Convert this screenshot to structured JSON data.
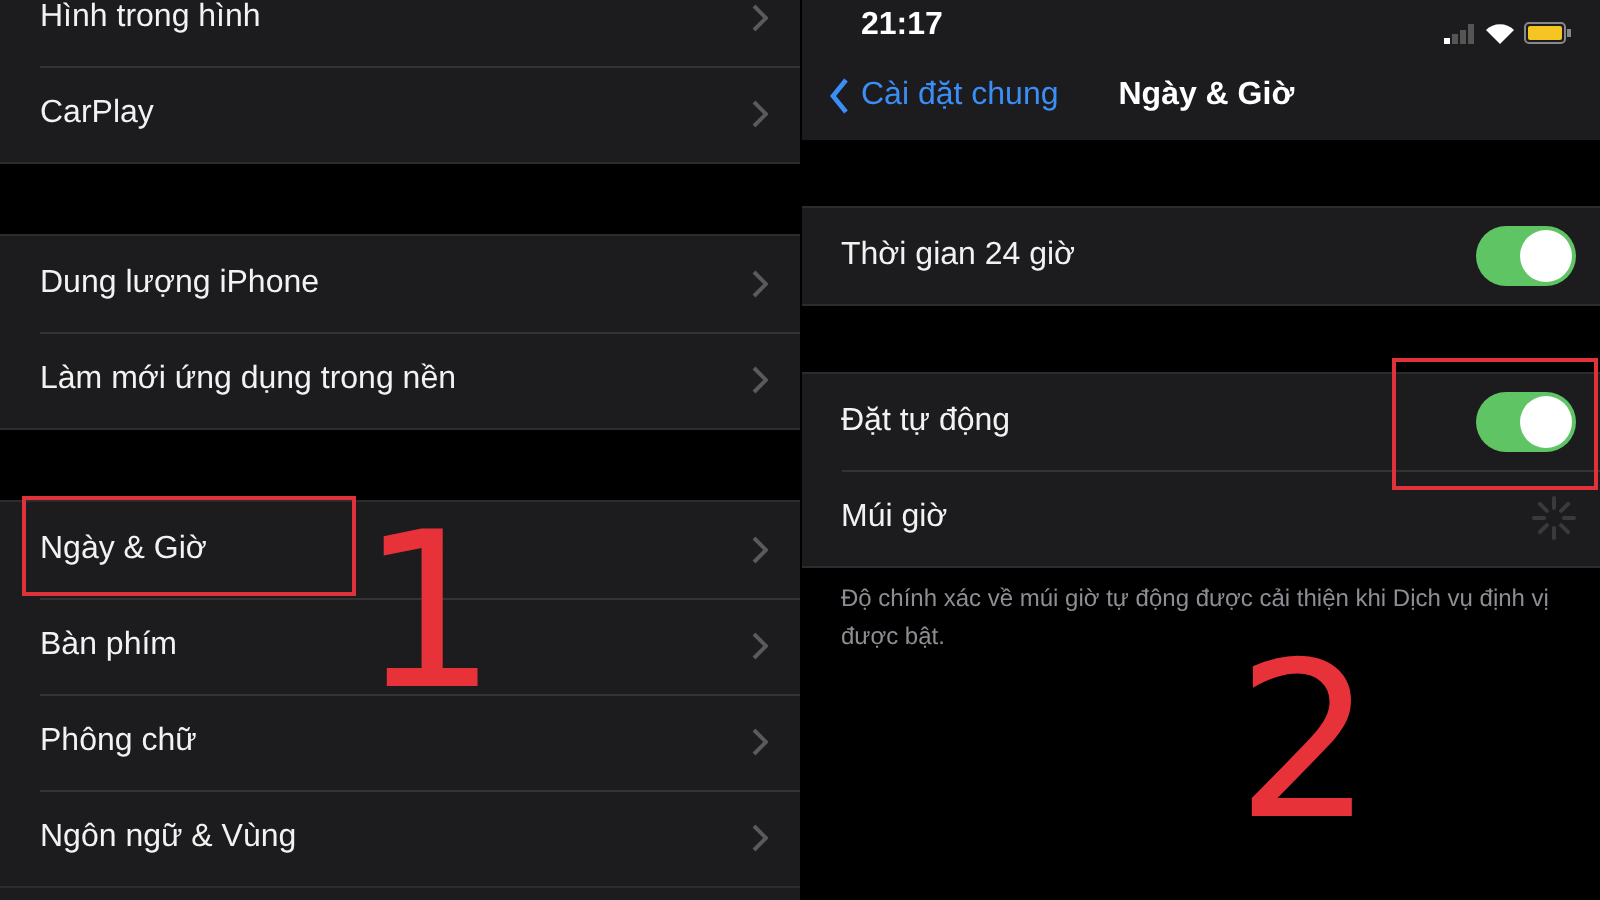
{
  "left_panel": {
    "groups": [
      {
        "rows": [
          {
            "label": "Hình trong hình"
          },
          {
            "label": "CarPlay"
          }
        ]
      },
      {
        "rows": [
          {
            "label": "Dung lượng iPhone"
          },
          {
            "label": "Làm mới ứng dụng trong nền"
          }
        ]
      },
      {
        "rows": [
          {
            "label": "Ngày & Giờ"
          },
          {
            "label": "Bàn phím"
          },
          {
            "label": "Phông chữ"
          },
          {
            "label": "Ngôn ngữ & Vùng"
          }
        ]
      }
    ]
  },
  "right_panel": {
    "status_bar": {
      "time": "21:17"
    },
    "nav_bar": {
      "back": "Cài đặt chung",
      "title": "Ngày & Giờ"
    },
    "groups": [
      {
        "rows": [
          {
            "kind": "toggle",
            "label": "Thời gian 24 giờ",
            "on": true
          }
        ]
      },
      {
        "rows": [
          {
            "kind": "toggle",
            "label": "Đặt tự động",
            "on": true
          },
          {
            "kind": "loading",
            "label": "Múi giờ"
          }
        ],
        "footer": "Độ chính xác về múi giờ tự động được cải thiện khi Dịch vụ định vị được bật."
      }
    ]
  },
  "annotations": [
    {
      "label": "1"
    },
    {
      "label": "2"
    }
  ]
}
